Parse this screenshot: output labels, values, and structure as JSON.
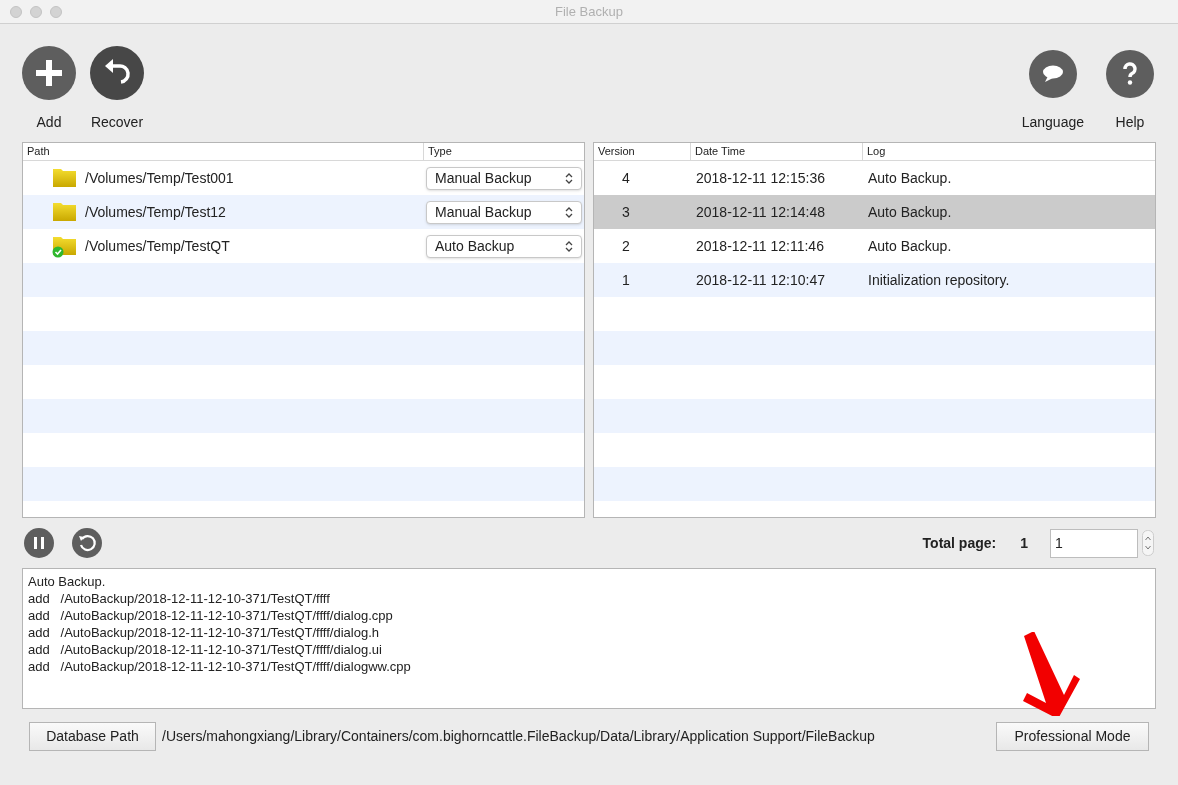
{
  "window": {
    "title": "File Backup"
  },
  "toolbar_left": [
    {
      "label": "Add",
      "kind": "add"
    },
    {
      "label": "Recover",
      "kind": "recover"
    }
  ],
  "toolbar_right": [
    {
      "label": "Language",
      "kind": "language"
    },
    {
      "label": "Help",
      "kind": "help"
    }
  ],
  "paths_table": {
    "columns": [
      "Path",
      "Type"
    ],
    "rows": [
      {
        "path": "/Volumes/Temp/Test001",
        "type": "Manual Backup",
        "synced": false
      },
      {
        "path": "/Volumes/Temp/Test12",
        "type": "Manual Backup",
        "synced": false
      },
      {
        "path": "/Volumes/Temp/TestQT",
        "type": "Auto Backup",
        "synced": true
      }
    ]
  },
  "versions_table": {
    "columns": [
      "Version",
      "Date Time",
      "Log"
    ],
    "rows": [
      {
        "version": "4",
        "date_time": "2018-12-11 12:15:36",
        "log": "Auto Backup.",
        "selected": false
      },
      {
        "version": "3",
        "date_time": "2018-12-11 12:14:48",
        "log": "Auto Backup.",
        "selected": true
      },
      {
        "version": "2",
        "date_time": "2018-12-11 12:11:46",
        "log": "Auto Backup.",
        "selected": false
      },
      {
        "version": "1",
        "date_time": "2018-12-11 12:10:47",
        "log": "Initialization repository.",
        "selected": false
      }
    ]
  },
  "pager": {
    "label": "Total page:",
    "total": "1",
    "value": "1"
  },
  "log_lines": [
    "Auto Backup.",
    "add   /AutoBackup/2018-12-11-12-10-371/TestQT/ffff",
    "add   /AutoBackup/2018-12-11-12-10-371/TestQT/ffff/dialog.cpp",
    "add   /AutoBackup/2018-12-11-12-10-371/TestQT/ffff/dialog.h",
    "add   /AutoBackup/2018-12-11-12-10-371/TestQT/ffff/dialog.ui",
    "add   /AutoBackup/2018-12-11-12-10-371/TestQT/ffff/dialogww.cpp"
  ],
  "footer": {
    "database_button": "Database Path",
    "database_path": "/Users/mahongxiang/Library/Containers/com.bighorncattle.FileBackup/Data/Library/Application Support/FileBackup",
    "mode_button": "Professional Mode"
  }
}
